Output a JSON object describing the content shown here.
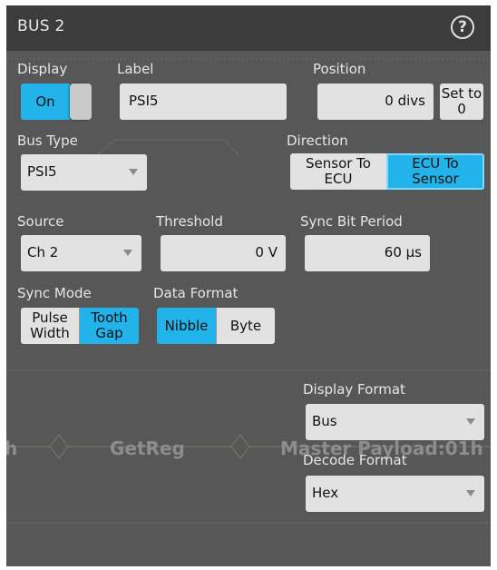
{
  "header": {
    "title": "BUS 2",
    "help_icon": "help-icon",
    "help_glyph": "?"
  },
  "display": {
    "label": "Display",
    "toggle_state": "On"
  },
  "label_field": {
    "label": "Label",
    "value": "PSI5"
  },
  "position": {
    "label": "Position",
    "value": "0 divs",
    "set_button": "Set to 0"
  },
  "bus_type": {
    "label": "Bus Type",
    "value": "PSI5"
  },
  "direction": {
    "label": "Direction",
    "options": [
      "Sensor To ECU",
      "ECU To Sensor"
    ],
    "selected": "ECU To Sensor"
  },
  "source": {
    "label": "Source",
    "value": "Ch 2"
  },
  "threshold": {
    "label": "Threshold",
    "value": "0 V"
  },
  "sync_bit_period": {
    "label": "Sync Bit Period",
    "value": "60 µs"
  },
  "sync_mode": {
    "label": "Sync Mode",
    "options": [
      "Pulse Width",
      "Tooth Gap"
    ],
    "selected": "Tooth Gap"
  },
  "data_format": {
    "label": "Data Format",
    "options": [
      "Nibble",
      "Byte"
    ],
    "selected": "Nibble"
  },
  "display_format": {
    "label": "Display Format",
    "value": "Bus"
  },
  "decode_format": {
    "label": "Decode Format",
    "value": "Hex"
  },
  "background_trace": {
    "labels": [
      "h",
      "GetReg",
      "Master Payload:01h"
    ]
  },
  "colors": {
    "accent": "#22b3ea",
    "panel": "#575757",
    "header": "#3c3c3c",
    "field": "#e2e2e2"
  }
}
